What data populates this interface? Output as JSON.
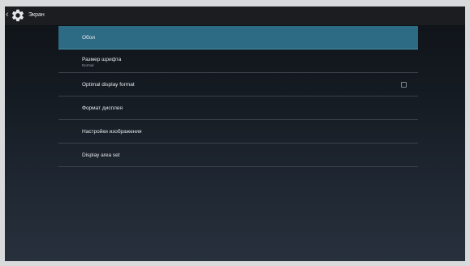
{
  "action_bar": {
    "back_glyph": "‹",
    "settings_icon": "gear-icon",
    "title": "Экран"
  },
  "menu": {
    "items": [
      {
        "label": "Обои",
        "selected": true
      },
      {
        "label": "Размер шрифта",
        "summary": "Normal"
      },
      {
        "label": "Optimal display format",
        "checkbox_checked": false
      },
      {
        "label": "Формат дисплея"
      },
      {
        "label": "Настройки изображения"
      },
      {
        "label": "Display area set"
      }
    ]
  },
  "colors": {
    "selected_item": "#2d6b84",
    "action_bar": "#1b1d20"
  }
}
